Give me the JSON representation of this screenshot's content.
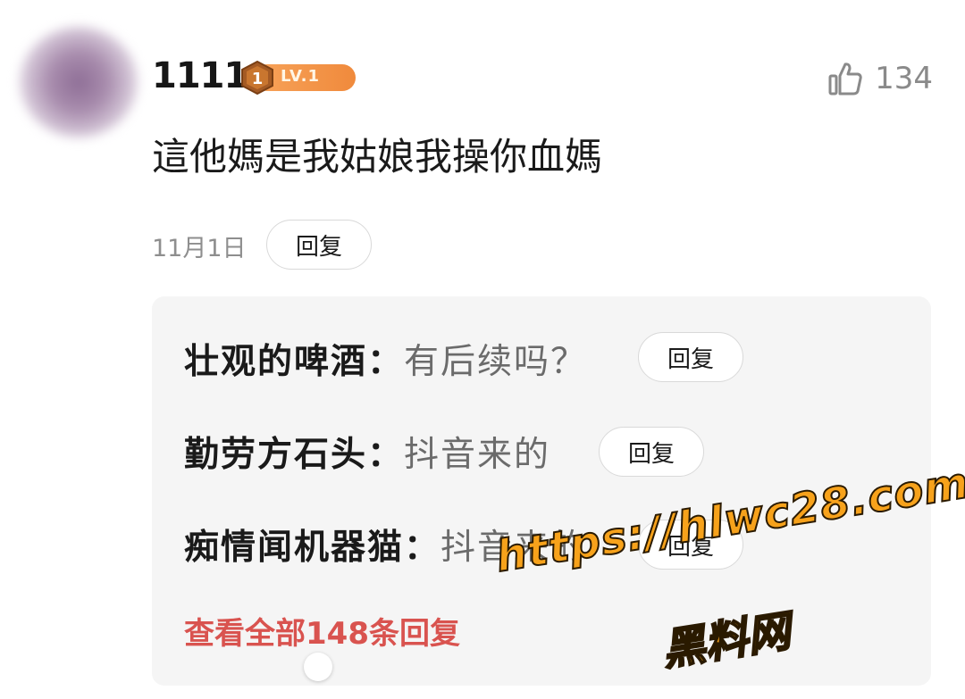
{
  "comment": {
    "username": "1111",
    "level_badge": {
      "number": "1",
      "label": "LV.1"
    },
    "likes": {
      "icon": "thumbs-up-icon",
      "count": "134"
    },
    "text": "這他媽是我姑娘我操你血媽",
    "date": "11月1日",
    "reply_label": "回复"
  },
  "replies": [
    {
      "name": "壮观的啤酒：",
      "text": "有后续吗？",
      "reply_label": "回复"
    },
    {
      "name": "勤劳方石头：",
      "text": "抖音来的",
      "reply_label": "回复"
    },
    {
      "name": "痴情闻机器猫：",
      "text": "抖音来的",
      "reply_label": "回复"
    }
  ],
  "view_all": "查看全部148条回复",
  "watermark": {
    "line1": "https://hlwc28.com",
    "line2": "黑料网"
  },
  "colors": {
    "accent_red": "#d9534f",
    "badge_orange": "#f08a3c",
    "watermark_orange": "#f7a21b"
  }
}
